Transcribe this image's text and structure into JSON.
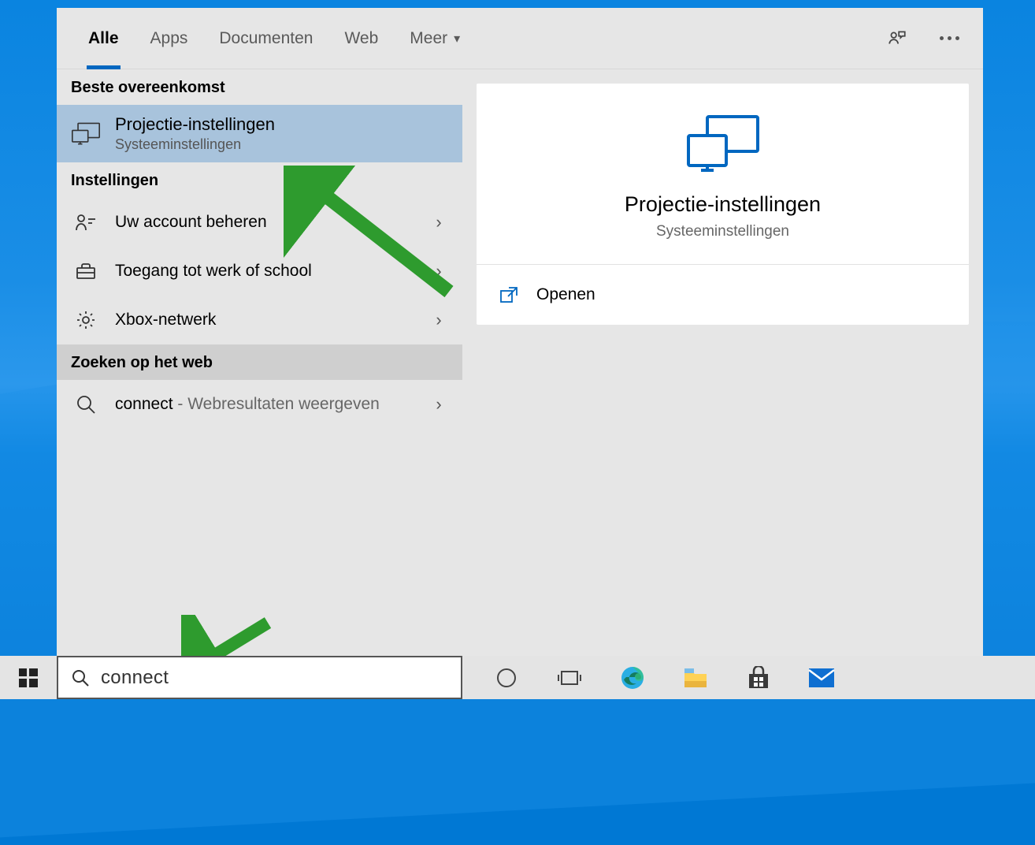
{
  "tabs": {
    "all": "Alle",
    "apps": "Apps",
    "documents": "Documenten",
    "web": "Web",
    "more": "Meer"
  },
  "sections": {
    "best_match": "Beste overeenkomst",
    "settings": "Instellingen",
    "web_search": "Zoeken op het web"
  },
  "best_match": {
    "title": "Projectie-instellingen",
    "subtitle": "Systeeminstellingen"
  },
  "settings_items": [
    {
      "label": "Uw account beheren"
    },
    {
      "label": "Toegang tot werk of school"
    },
    {
      "label": "Xbox-netwerk"
    }
  ],
  "web_item": {
    "term": "connect",
    "hint": " - Webresultaten weergeven"
  },
  "detail": {
    "title": "Projectie-instellingen",
    "subtitle": "Systeeminstellingen",
    "action_open": "Openen"
  },
  "search": {
    "value": "connect"
  }
}
